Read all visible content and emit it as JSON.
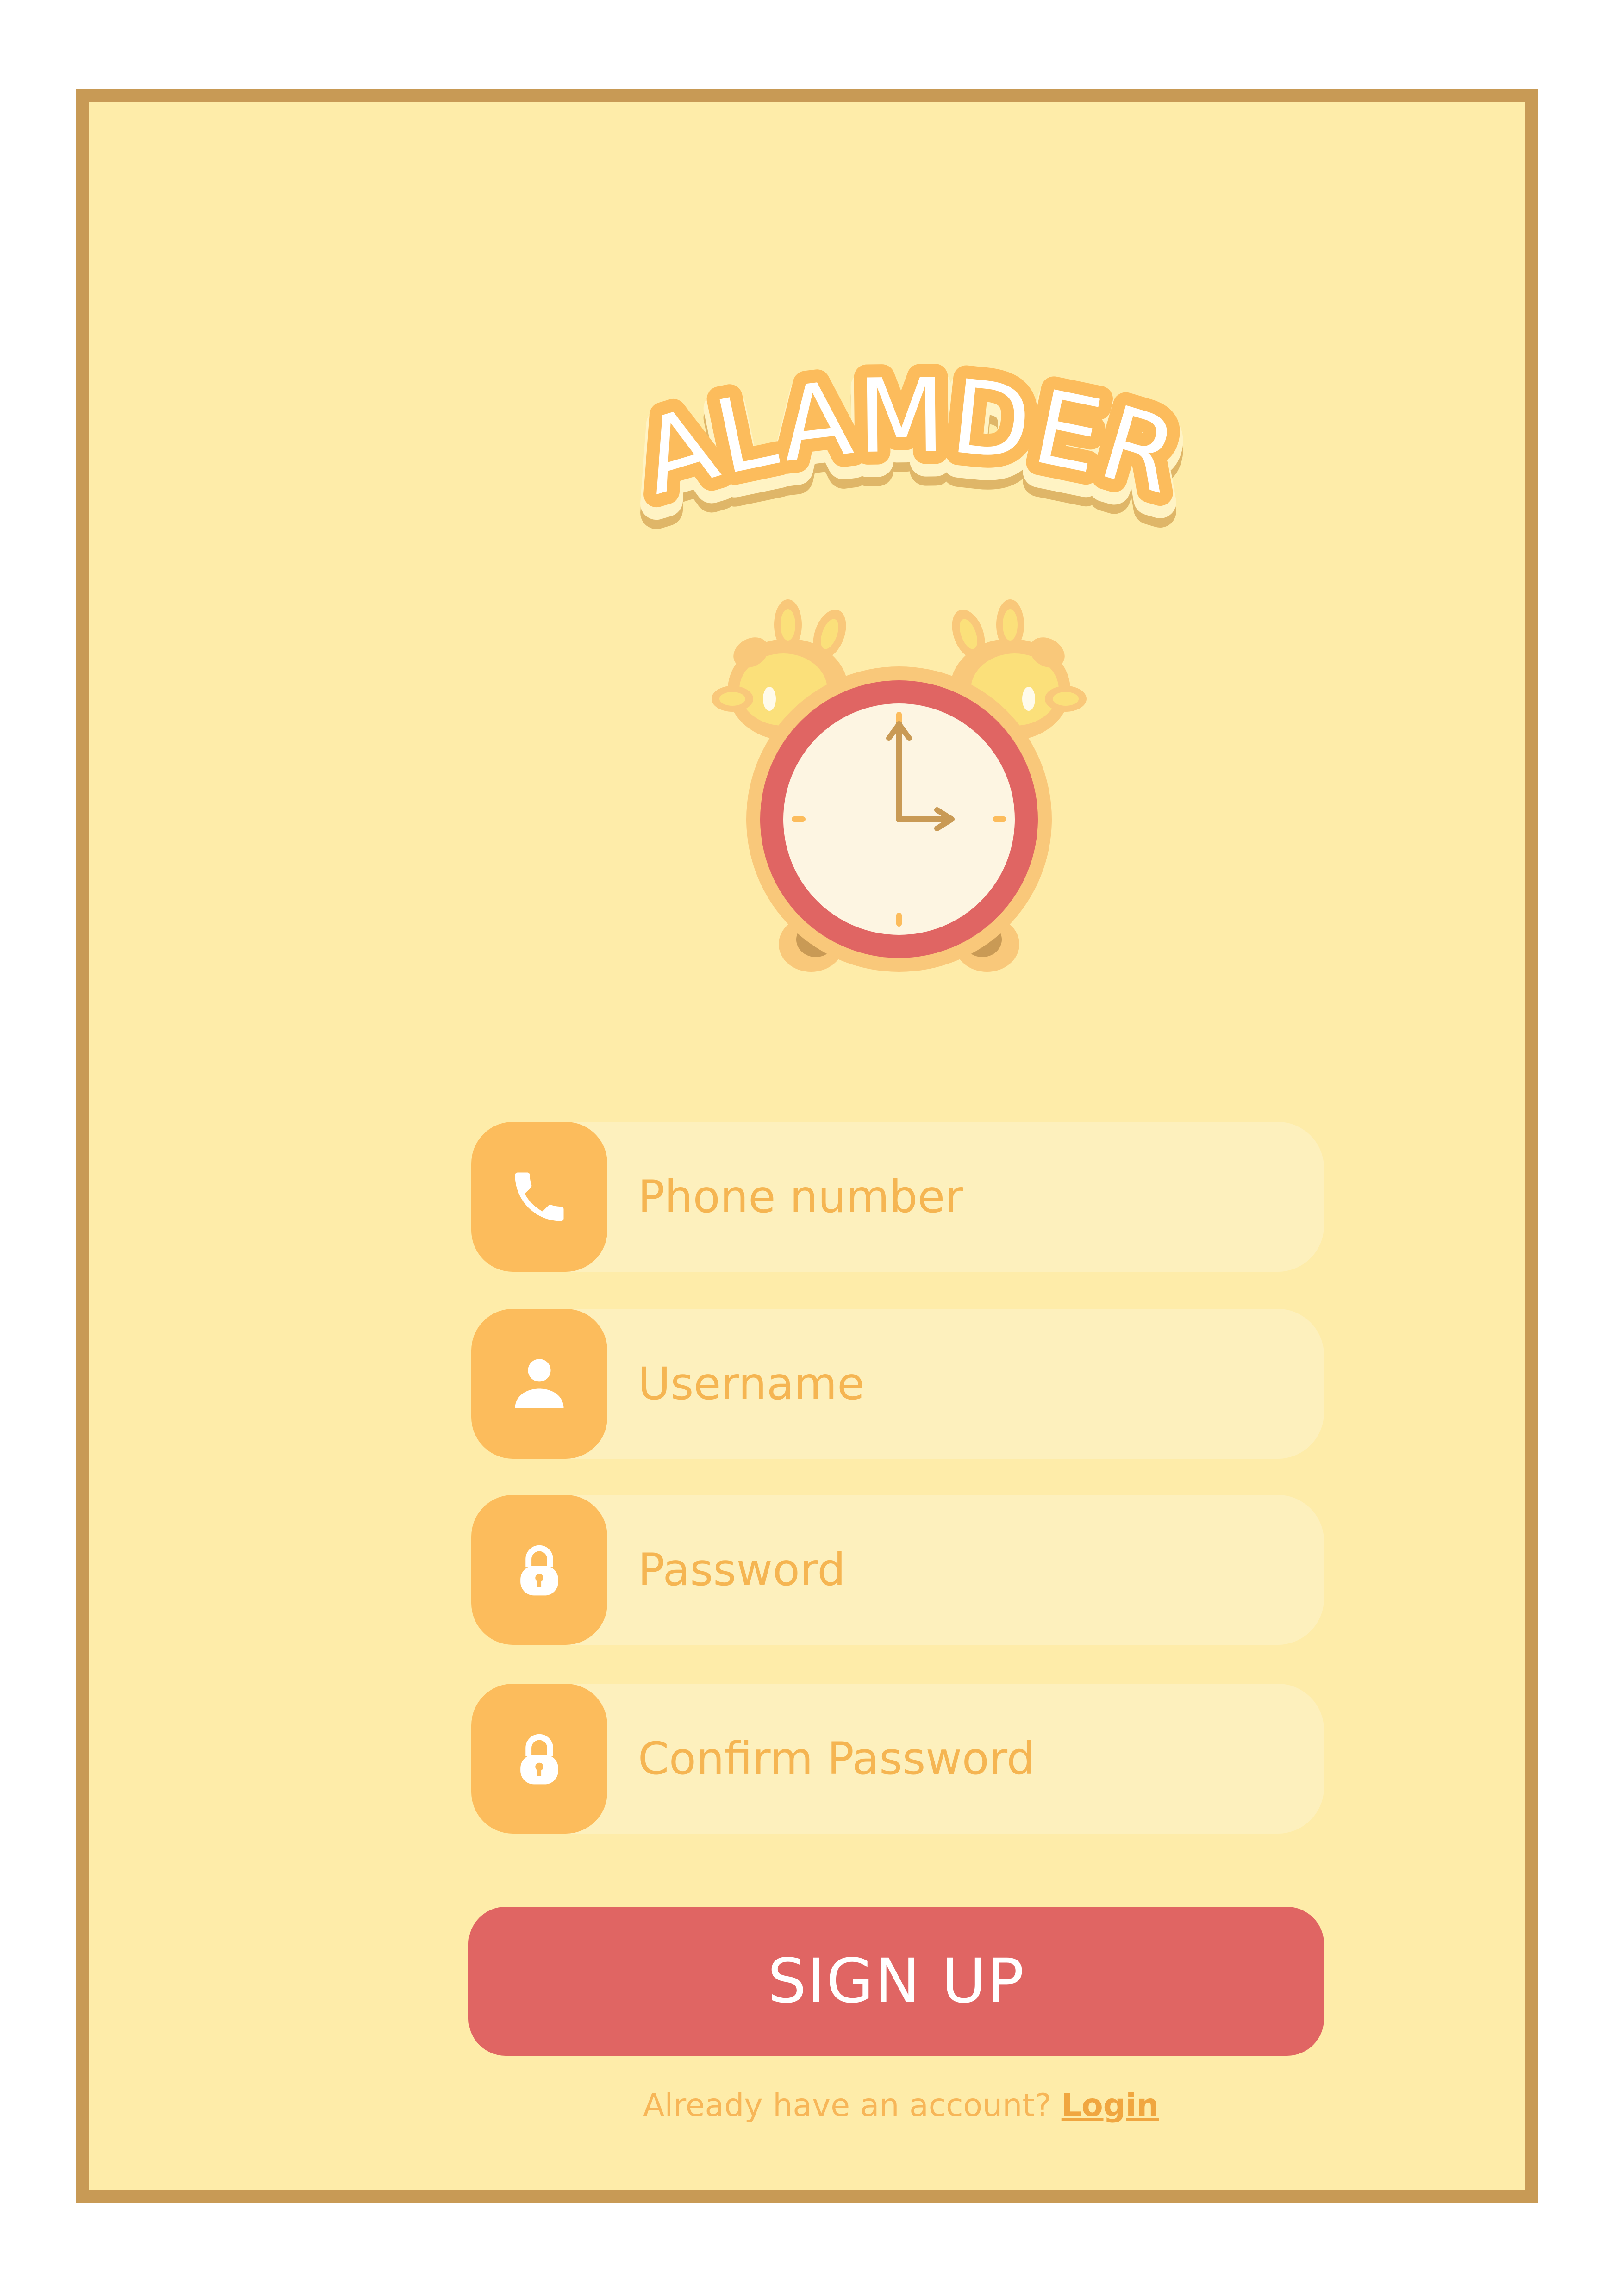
{
  "app": {
    "title": "ALAMDER"
  },
  "form": {
    "phone": {
      "placeholder": "Phone number",
      "icon": "phone-icon"
    },
    "username": {
      "placeholder": "Username",
      "icon": "user-icon"
    },
    "password": {
      "placeholder": "Password",
      "icon": "lock-icon"
    },
    "confirm_password": {
      "placeholder": "Confirm Password",
      "icon": "lock-icon"
    }
  },
  "actions": {
    "signup_label": "SIGN UP",
    "login_prompt": "Already have an account?",
    "login_link": "Login"
  },
  "colors": {
    "frame_border": "#c89a55",
    "background": "#feeca9",
    "field_bg": "#fdf0bd",
    "icon_bg": "#fcbc5c",
    "accent_text": "#f5b552",
    "button": "#e06563",
    "clock_ring": "#e06563"
  }
}
